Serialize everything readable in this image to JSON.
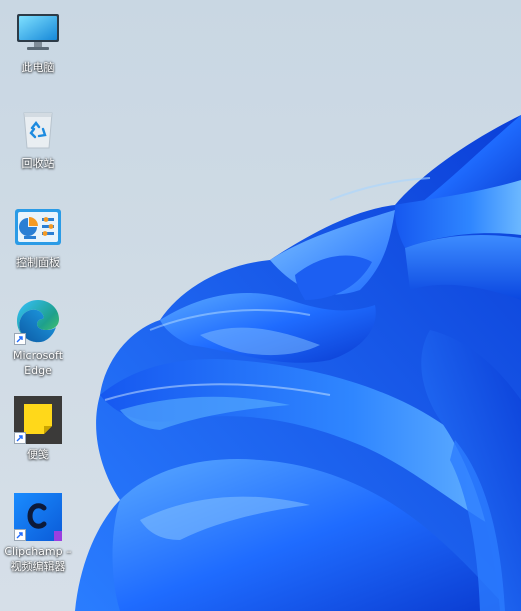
{
  "desktop": {
    "icons": [
      {
        "id": "this-pc",
        "label": "此电脑",
        "icon": "monitor-icon",
        "shortcut": false
      },
      {
        "id": "recycle-bin",
        "label": "回收站",
        "icon": "recycle-bin-icon",
        "shortcut": false
      },
      {
        "id": "control-panel",
        "label": "控制面板",
        "icon": "control-panel-icon",
        "shortcut": false
      },
      {
        "id": "microsoft-edge",
        "label": "Microsoft\nEdge",
        "icon": "edge-icon",
        "shortcut": true
      },
      {
        "id": "sticky-notes",
        "label": "便笺",
        "icon": "sticky-notes-icon",
        "shortcut": true
      },
      {
        "id": "clipchamp",
        "label": "Clipchamp –\n视频编辑器",
        "icon": "clipchamp-icon",
        "shortcut": true
      }
    ]
  },
  "colors": {
    "wallpaper_background": "#cfdbe5",
    "bloom_blue_dark": "#0a3fd6",
    "bloom_blue_mid": "#1a6bff",
    "bloom_blue_light": "#4aa3ff",
    "label_text": "#ffffff"
  }
}
